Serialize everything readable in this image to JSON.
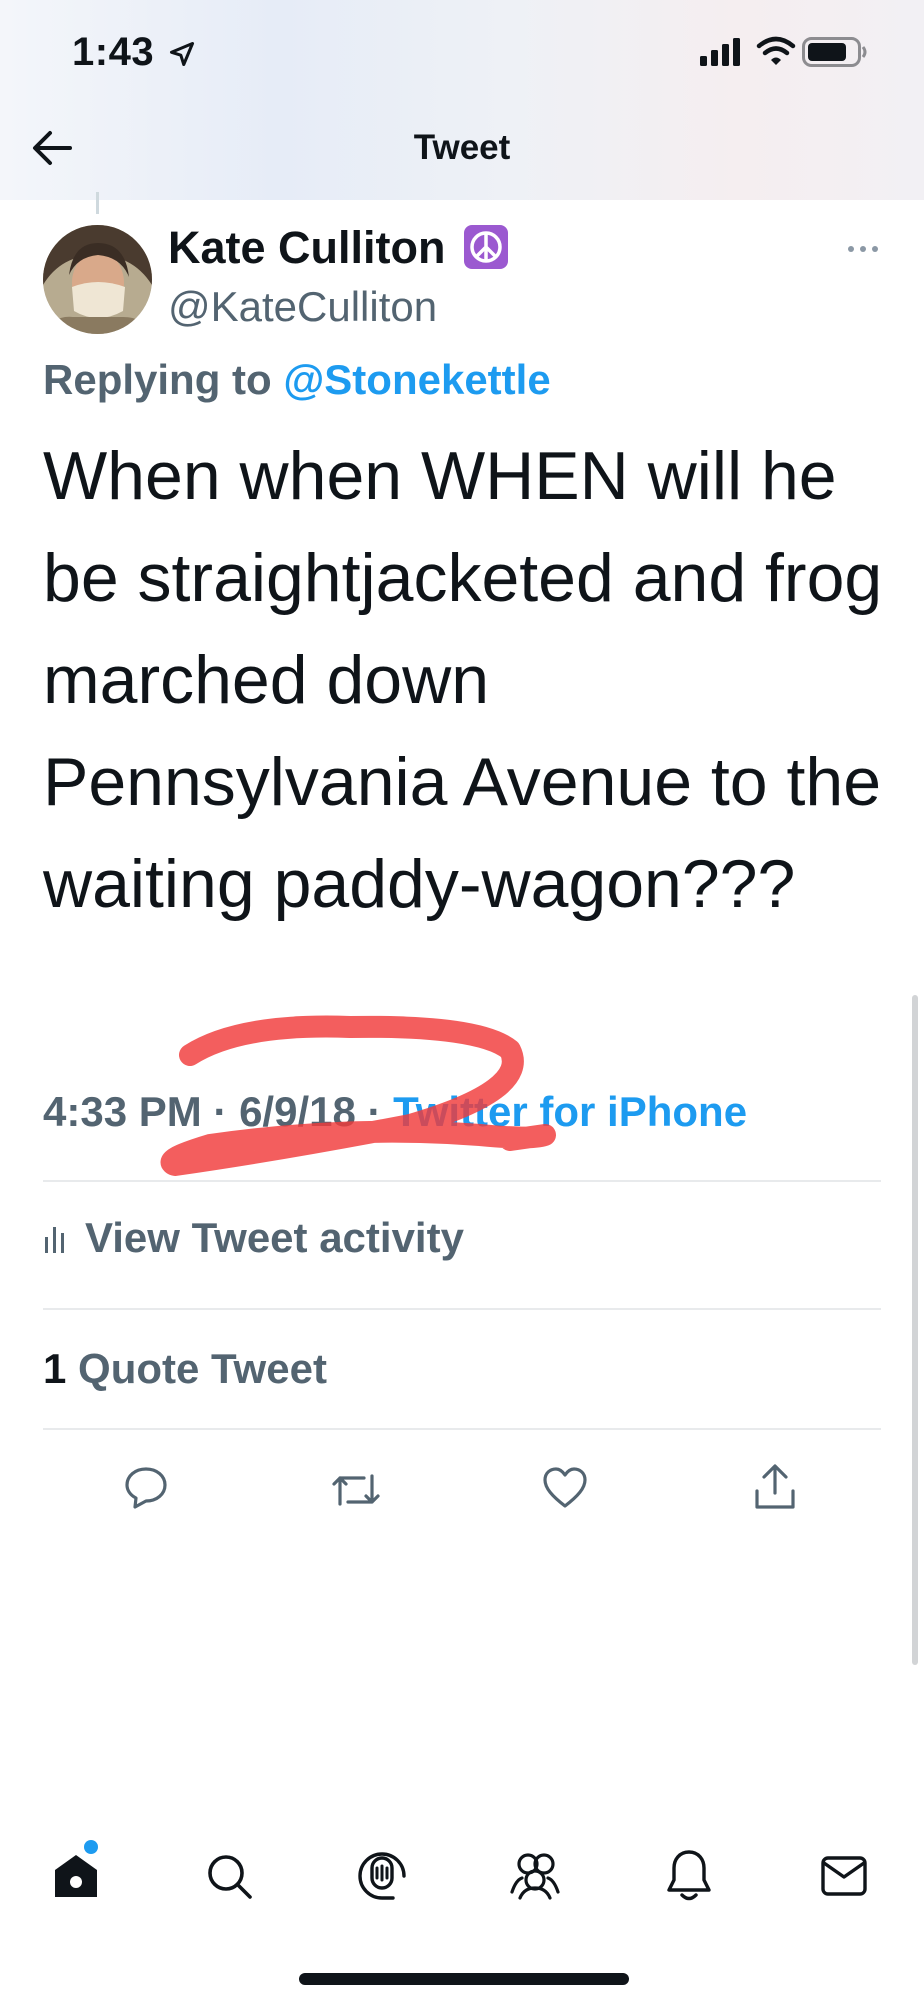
{
  "status_bar": {
    "time": "1:43"
  },
  "header": {
    "title": "Tweet"
  },
  "tweet": {
    "author_name": "Kate Culliton",
    "author_handle": "@KateCulliton",
    "replying_prefix": "Replying to ",
    "replying_to": "@Stonekettle",
    "text": "When when WHEN will he be straightjacketed and frog marched down Pennsylvania Avenue to the waiting paddy-wagon???",
    "time": "4:33 PM",
    "date": "6/9/18",
    "separator": " · ",
    "source": "Twitter for iPhone",
    "activity_label": "View Tweet activity",
    "quote_count": "1",
    "quote_label": " Quote Tweet"
  },
  "colors": {
    "accent": "#1d9bf0",
    "secondary_text": "#536471",
    "annotation": "#f03a3a",
    "badge": "#9b59d0"
  },
  "actions": [
    "reply-icon",
    "retweet-icon",
    "like-icon",
    "share-icon"
  ],
  "nav": [
    "home-icon",
    "search-icon",
    "spaces-icon",
    "communities-icon",
    "notifications-icon",
    "messages-icon"
  ]
}
